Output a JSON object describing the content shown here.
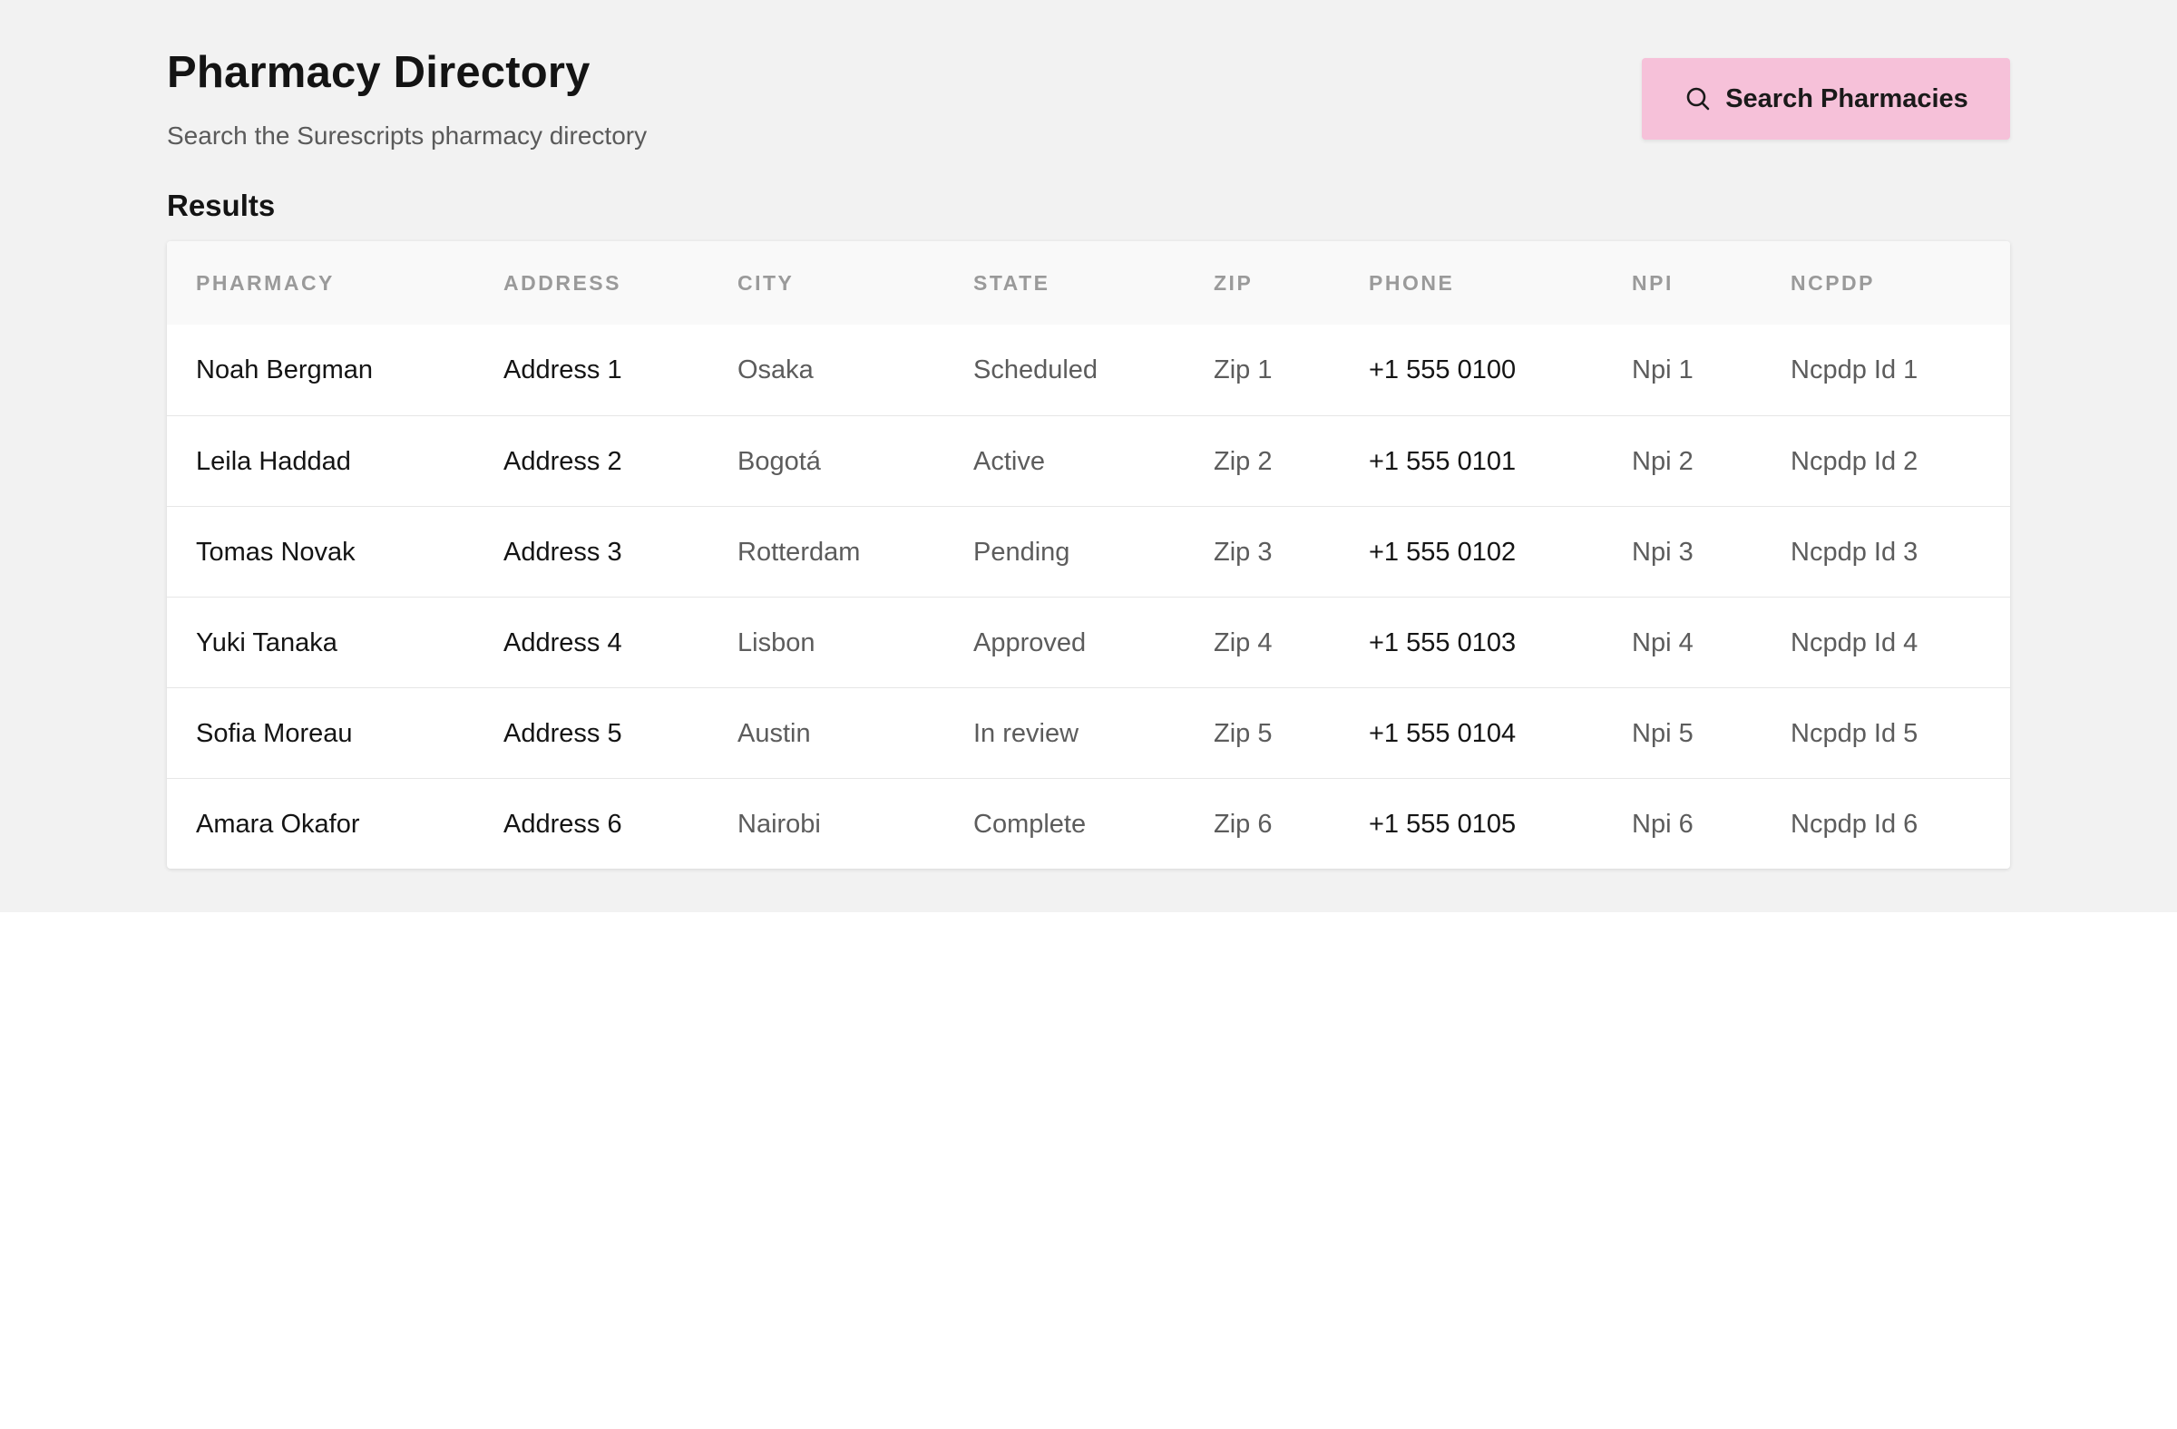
{
  "header": {
    "title": "Pharmacy Directory",
    "subtitle": "Search the Surescripts pharmacy directory",
    "search_button_label": "Search Pharmacies",
    "search_button_icon": "search-icon",
    "search_button_color": "#f6c1d9"
  },
  "results": {
    "title": "Results",
    "columns": [
      "PHARMACY",
      "ADDRESS",
      "CITY",
      "STATE",
      "ZIP",
      "PHONE",
      "NPI",
      "NCPDP"
    ],
    "rows": [
      [
        "Noah Bergman",
        "Address 1",
        "Osaka",
        "Scheduled",
        "Zip 1",
        "+1 555 0100",
        "Npi 1",
        "Ncpdp Id 1"
      ],
      [
        "Leila Haddad",
        "Address 2",
        "Bogotá",
        "Active",
        "Zip 2",
        "+1 555 0101",
        "Npi 2",
        "Ncpdp Id 2"
      ],
      [
        "Tomas Novak",
        "Address 3",
        "Rotterdam",
        "Pending",
        "Zip 3",
        "+1 555 0102",
        "Npi 3",
        "Ncpdp Id 3"
      ],
      [
        "Yuki Tanaka",
        "Address 4",
        "Lisbon",
        "Approved",
        "Zip 4",
        "+1 555 0103",
        "Npi 4",
        "Ncpdp Id 4"
      ],
      [
        "Sofia Moreau",
        "Address 5",
        "Austin",
        "In review",
        "Zip 5",
        "+1 555 0104",
        "Npi 5",
        "Ncpdp Id 5"
      ],
      [
        "Amara Okafor",
        "Address 6",
        "Nairobi",
        "Complete",
        "Zip 6",
        "+1 555 0105",
        "Npi 6",
        "Ncpdp Id 6"
      ]
    ]
  }
}
